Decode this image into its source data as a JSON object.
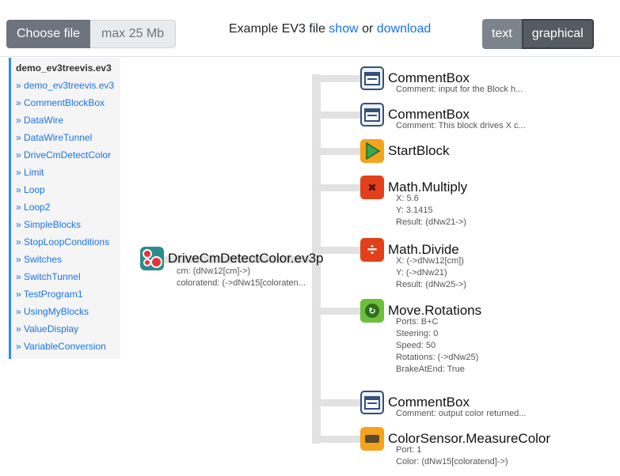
{
  "upload": {
    "choose_label": "Choose file",
    "max_label": "max 25 Mb"
  },
  "example": {
    "prefix": "Example EV3 file",
    "show": "show",
    "or": "or",
    "download": "download"
  },
  "view_toggle": {
    "text": "text",
    "graphical": "graphical",
    "active": "graphical"
  },
  "sidebar": {
    "title": "demo_ev3treevis.ev3",
    "items": [
      "demo_ev3treevis.ev3",
      "CommentBlockBox",
      "DataWire",
      "DataWireTunnel",
      "DriveCmDetectColor",
      "Limit",
      "Loop",
      "Loop2",
      "SimpleBlocks",
      "StopLoopConditions",
      "Switches",
      "SwitchTunnel",
      "TestProgram1",
      "UsingMyBlocks",
      "ValueDisplay",
      "VariableConversion"
    ],
    "accent": "#2a8cf2"
  },
  "root": {
    "title": "DriveCmDetectColor.ev3p",
    "lines": [
      "cm: (dNw12[cm]->)",
      "coloratend: (->dNw15[coloraten..."
    ]
  },
  "blocks": [
    {
      "icon": "comment-icon",
      "title": "CommentBox",
      "lines": [
        "Comment: input for the Block h..."
      ]
    },
    {
      "icon": "comment-icon",
      "title": "CommentBox",
      "lines": [
        "Comment: This block drives X c..."
      ]
    },
    {
      "icon": "start-icon",
      "title": "StartBlock",
      "lines": []
    },
    {
      "icon": "multiply-icon",
      "title": "Math.Multiply",
      "lines": [
        "X: 5.6",
        "Y: 3.1415",
        "Result: (dNw21->)"
      ]
    },
    {
      "icon": "divide-icon",
      "title": "Math.Divide",
      "lines": [
        "X: (->dNw12[cm])",
        "Y: (->dNw21)",
        "Result: (dNw25->)"
      ]
    },
    {
      "icon": "move-icon",
      "title": "Move.Rotations",
      "lines": [
        "Ports: B+C",
        "Steering: 0",
        "Speed: 50",
        "Rotations: (->dNw25)",
        "BrakeAtEnd: True"
      ]
    },
    {
      "icon": "comment-icon",
      "title": "CommentBox",
      "lines": [
        "Comment: output color returned..."
      ]
    },
    {
      "icon": "color-sensor-icon",
      "title": "ColorSensor.MeasureColor",
      "lines": [
        "Port: 1",
        "Color: (dNw15[coloratend]->)"
      ]
    }
  ]
}
